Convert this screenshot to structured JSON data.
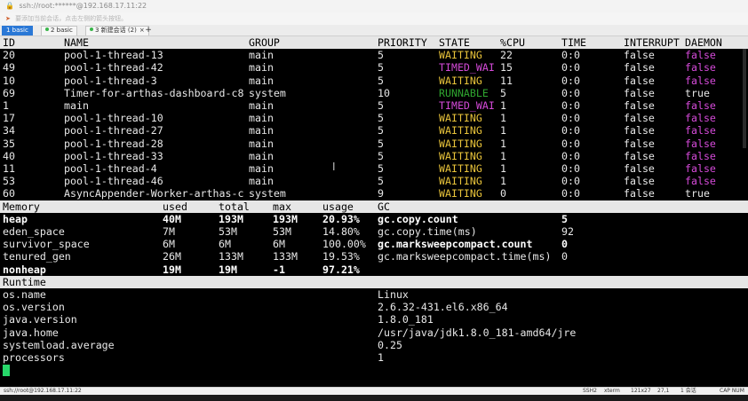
{
  "window": {
    "title": "ssh://root:******@192.168.17.11:22"
  },
  "hint": {
    "text": "要添加当前会话，点击左侧的箭头按钮。"
  },
  "tabs": [
    {
      "label": "1 basic",
      "active": true
    },
    {
      "label": "2 basic",
      "active": false
    },
    {
      "label": "3 新建会话 (2)",
      "active": false
    }
  ],
  "threads": {
    "headers": [
      "ID",
      "NAME",
      "GROUP",
      "PRIORITY",
      "STATE",
      "%CPU",
      "TIME",
      "INTERRUPT",
      "DAEMON"
    ],
    "rows": [
      [
        "20",
        "pool-1-thread-13",
        "main",
        "5",
        "WAITING",
        "22",
        "0:0",
        "false",
        "false"
      ],
      [
        "49",
        "pool-1-thread-42",
        "main",
        "5",
        "TIMED_WAI",
        "15",
        "0:0",
        "false",
        "false"
      ],
      [
        "10",
        "pool-1-thread-3",
        "main",
        "5",
        "WAITING",
        "11",
        "0:0",
        "false",
        "false"
      ],
      [
        "69",
        "Timer-for-arthas-dashboard-c8",
        "system",
        "10",
        "RUNNABLE",
        "5",
        "0:0",
        "false",
        "true"
      ],
      [
        "1",
        "main",
        "main",
        "5",
        "TIMED_WAI",
        "1",
        "0:0",
        "false",
        "false"
      ],
      [
        "17",
        "pool-1-thread-10",
        "main",
        "5",
        "WAITING",
        "1",
        "0:0",
        "false",
        "false"
      ],
      [
        "34",
        "pool-1-thread-27",
        "main",
        "5",
        "WAITING",
        "1",
        "0:0",
        "false",
        "false"
      ],
      [
        "35",
        "pool-1-thread-28",
        "main",
        "5",
        "WAITING",
        "1",
        "0:0",
        "false",
        "false"
      ],
      [
        "40",
        "pool-1-thread-33",
        "main",
        "5",
        "WAITING",
        "1",
        "0:0",
        "false",
        "false"
      ],
      [
        "11",
        "pool-1-thread-4",
        "main",
        "5",
        "WAITING",
        "1",
        "0:0",
        "false",
        "false"
      ],
      [
        "53",
        "pool-1-thread-46",
        "main",
        "5",
        "WAITING",
        "1",
        "0:0",
        "false",
        "false"
      ],
      [
        "60",
        "AsyncAppender-Worker-arthas-c",
        "system",
        "9",
        "WAITING",
        "0",
        "0:0",
        "false",
        "true"
      ]
    ]
  },
  "memory": {
    "headers": [
      "Memory",
      "used",
      "total",
      "max",
      "usage",
      "GC"
    ],
    "rows": [
      {
        "name": "heap",
        "used": "40M",
        "total": "193M",
        "max": "193M",
        "usage": "20.93%",
        "gc_name": "gc.copy.count",
        "gc_value": "5",
        "bold": true,
        "gc_bold": true
      },
      {
        "name": "eden_space",
        "used": "7M",
        "total": "53M",
        "max": "53M",
        "usage": "14.80%",
        "gc_name": "gc.copy.time(ms)",
        "gc_value": "92",
        "bold": false,
        "gc_bold": false
      },
      {
        "name": "survivor_space",
        "used": "6M",
        "total": "6M",
        "max": "6M",
        "usage": "100.00%",
        "gc_name": "gc.marksweepcompact.count",
        "gc_value": "0",
        "bold": false,
        "gc_bold": true
      },
      {
        "name": "tenured_gen",
        "used": "26M",
        "total": "133M",
        "max": "133M",
        "usage": "19.53%",
        "gc_name": "gc.marksweepcompact.time(ms)",
        "gc_value": "0",
        "bold": false,
        "gc_bold": false
      },
      {
        "name": "nonheap",
        "used": "19M",
        "total": "19M",
        "max": "-1",
        "usage": "97.21%",
        "gc_name": "",
        "gc_value": "",
        "bold": true,
        "gc_bold": false
      }
    ]
  },
  "runtime": {
    "header": "Runtime",
    "rows": [
      [
        "os.name",
        "Linux"
      ],
      [
        "os.version",
        "2.6.32-431.el6.x86_64"
      ],
      [
        "java.version",
        "1.8.0_181"
      ],
      [
        "java.home",
        "/usr/java/jdk1.8.0_181-amd64/jre"
      ],
      [
        "systemload.average",
        "0.25"
      ],
      [
        "processors",
        "1"
      ]
    ]
  },
  "statusbar": {
    "session": "ssh://root@192.168.17.11:22",
    "protocol": "SSH2",
    "terminal": "xterm",
    "size": "121x27",
    "cursor_pos": "27,1",
    "sessions": "1 会话",
    "caps": "CAP NUM"
  },
  "colors": {
    "waiting": "#e8c33a",
    "timed_waiting": "#d44ad8",
    "runnable": "#2fa52f",
    "false_daemon": "#d44ad8",
    "header_bg": "#e6e6e6",
    "cursor": "#27d86a",
    "active_tab": "#2a78d6"
  }
}
